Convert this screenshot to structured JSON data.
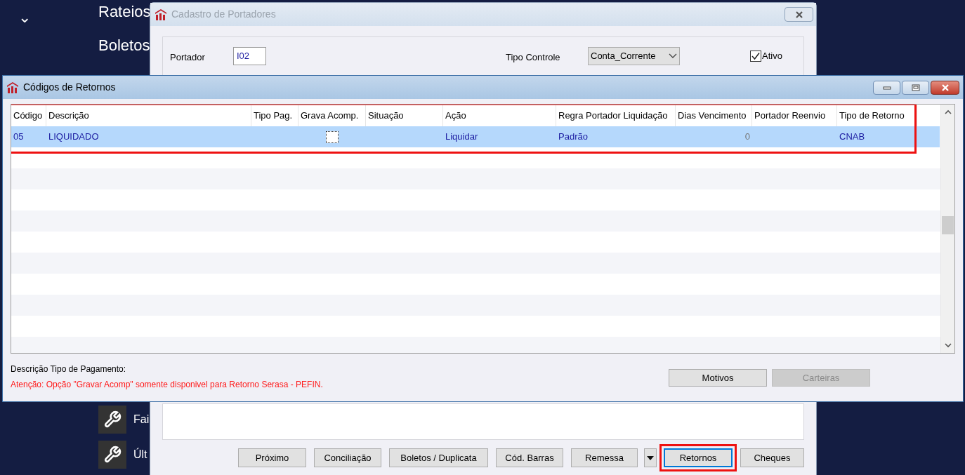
{
  "sidebar": {
    "expander": "⌄",
    "items": [
      {
        "label": "Rateios"
      },
      {
        "label": "Boletos"
      }
    ],
    "tools": [
      {
        "label": "Fai"
      },
      {
        "label": "Últ"
      }
    ]
  },
  "cadastro_window": {
    "title": "Cadastro de Portadores",
    "active": false,
    "portador": {
      "label": "Portador",
      "value": "I02"
    },
    "tipo_controle": {
      "label": "Tipo Controle",
      "value": "Conta_Corrente"
    },
    "ativo": {
      "label": "Ativo",
      "checked": true
    },
    "buttons": [
      {
        "label": "Próximo",
        "annotated": false,
        "focused": false
      },
      {
        "label": "Conciliação",
        "annotated": false,
        "focused": false
      },
      {
        "label": "Boletos / Duplicata",
        "annotated": false,
        "focused": false
      },
      {
        "label": "Cód. Barras",
        "annotated": false,
        "focused": false
      },
      {
        "label": "Remessa",
        "annotated": false,
        "focused": false,
        "dropdown": true
      },
      {
        "label": "Retornos",
        "annotated": true,
        "focused": true
      },
      {
        "label": "Cheques",
        "annotated": false,
        "focused": false
      }
    ]
  },
  "codigos_window": {
    "title": "Códigos de Retornos",
    "active": true,
    "table": {
      "annotated": true,
      "columns": [
        "Código",
        "Descrição",
        "Tipo Pag.",
        "Grava Acomp.",
        "Situação",
        "Ação",
        "Regra Portador Liquidação",
        "Dias Vencimento",
        "Portador Reenvio",
        "Tipo de Retorno"
      ],
      "rows": [
        {
          "selected": true,
          "codigo": "05",
          "descricao": "LIQUIDADO",
          "grava_acomp": false,
          "acao": "Liquidar",
          "regra": "Padrão",
          "dias": "0",
          "tipo_retorno": "CNAB"
        }
      ]
    },
    "descricao_label": "Descrição Tipo de Pagamento:",
    "warning": "Atenção: Opção \"Gravar Acomp\" somente disponivel para Retorno Serasa - PEFIN.",
    "buttons": [
      {
        "label": "Motivos",
        "disabled": false
      },
      {
        "label": "Carteiras",
        "disabled": true
      }
    ]
  }
}
